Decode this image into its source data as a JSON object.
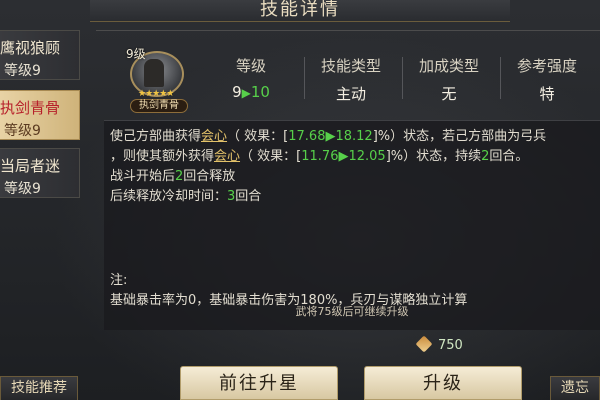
{
  "title": "技能详情",
  "skills": [
    {
      "name": "鹰视狼顾",
      "level": "等级9"
    },
    {
      "name": "执剑青骨",
      "level": "等级9"
    },
    {
      "name": "当局者迷",
      "level": "等级9"
    }
  ],
  "avatar": {
    "level": "9级",
    "name": "执剑青骨",
    "stars": "★★★★★"
  },
  "stats": {
    "level": {
      "label": "等级",
      "from": "9",
      "to": "10"
    },
    "type": {
      "label": "技能类型",
      "value": "主动"
    },
    "bonus": {
      "label": "加成类型",
      "value": "无"
    },
    "rating": {
      "label": "参考强度",
      "value": "特"
    }
  },
  "description": {
    "l1_a": "使己方部曲获得",
    "effect": "会心",
    "l1_b": "（ 效果：[",
    "l1_from": "17.68",
    "l1_to": "18.12",
    "l1_c": "]%）状态，若己方部曲为弓兵",
    "l2_a": "，则使其额外获得",
    "l2_b": "（ 效果：[",
    "l2_from": "11.76",
    "l2_to": "12.05",
    "l2_c": "]%）状态，持续",
    "l2_num": "2",
    "l2_d": "回合。",
    "l3_a": "战斗开始后",
    "l3_num": "2",
    "l3_b": "回合释放",
    "l4_a": "后续释放冷却时间：",
    "l4_num": "3",
    "l4_b": "回合",
    "note_title": "注:",
    "note_body": "基础暴击率为0，基础暴击伤害为180%，兵刃与谋略独立计算",
    "upgrade_hint": "武将75级后可继续升级"
  },
  "cost": {
    "value": "750"
  },
  "buttons": {
    "star": "前往升星",
    "upgrade": "升级",
    "left": "技能推荐",
    "right": "遗忘"
  }
}
